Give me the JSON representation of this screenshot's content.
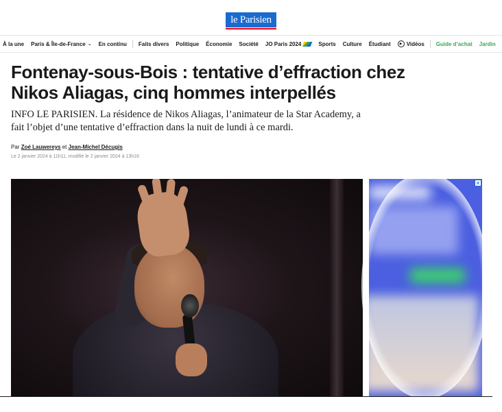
{
  "brand": {
    "logo_text": "le Parisien",
    "accent_color": "#1a6bcf",
    "underline_color": "#e2001a"
  },
  "nav": {
    "items": [
      {
        "label": "À la une"
      },
      {
        "label": "Paris & Île-de-France"
      },
      {
        "label": "En continu"
      },
      {
        "label": "Faits divers"
      },
      {
        "label": "Politique"
      },
      {
        "label": "Économie"
      },
      {
        "label": "Société"
      },
      {
        "label": "JO Paris 2024"
      },
      {
        "label": "Sports"
      },
      {
        "label": "Culture"
      },
      {
        "label": "Étudiant"
      },
      {
        "label": "Vidéos"
      },
      {
        "label": "Guide d’achat"
      },
      {
        "label": "Jardin"
      }
    ],
    "guide_color": "#3aa655"
  },
  "article": {
    "headline": "Fontenay-sous-Bois : tentative d’effraction chez Nikos Aliagas, cinq hommes interpellés",
    "lead": "INFO LE PARISIEN. La résidence de Nikos Aliagas, l’animateur de la Star Academy, a fait l’objet d’une tentative d’effraction dans la nuit de lundi à ce mardi.",
    "byline_prefix": "Par",
    "author_1": "Zoé Lauwereys",
    "byline_and": "et",
    "author_2": "Jean-Michel Décugis",
    "dates": "Le 2 janvier 2024 à 11h11, modifié le 2 janvier 2024 à 13h16"
  },
  "ad": {
    "close_label": "✕"
  }
}
